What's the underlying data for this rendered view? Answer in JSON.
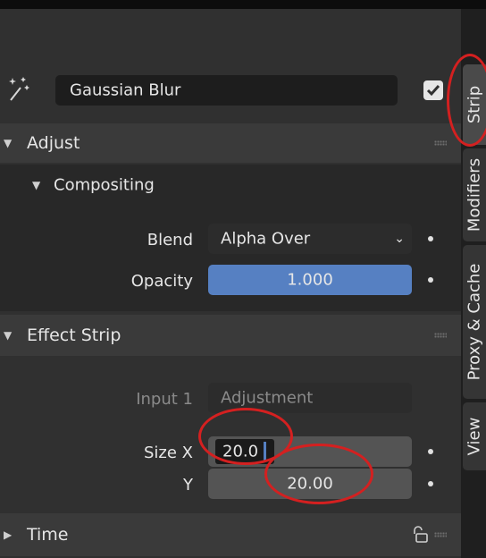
{
  "modifier": {
    "name": "Gaussian Blur",
    "enabled": true
  },
  "tabs": [
    {
      "label": "Strip",
      "active": true
    },
    {
      "label": "Modifiers",
      "active": false
    },
    {
      "label": "Proxy & Cache",
      "active": false
    },
    {
      "label": "View",
      "active": false
    }
  ],
  "adjust": {
    "title": "Adjust",
    "compositing": {
      "title": "Compositing",
      "blend_label": "Blend",
      "blend_value": "Alpha Over",
      "opacity_label": "Opacity",
      "opacity_value": "1.000",
      "opacity_fraction": 1.0
    }
  },
  "effect_strip": {
    "title": "Effect Strip",
    "input1_label": "Input 1",
    "input1_value": "Adjustment",
    "size_x_label": "Size X",
    "size_x_value": "20.0",
    "size_y_label": "Y",
    "size_y_value": "20.00"
  },
  "time": {
    "title": "Time"
  },
  "colors": {
    "accent": "#5680c2",
    "highlight": "#d42020"
  }
}
